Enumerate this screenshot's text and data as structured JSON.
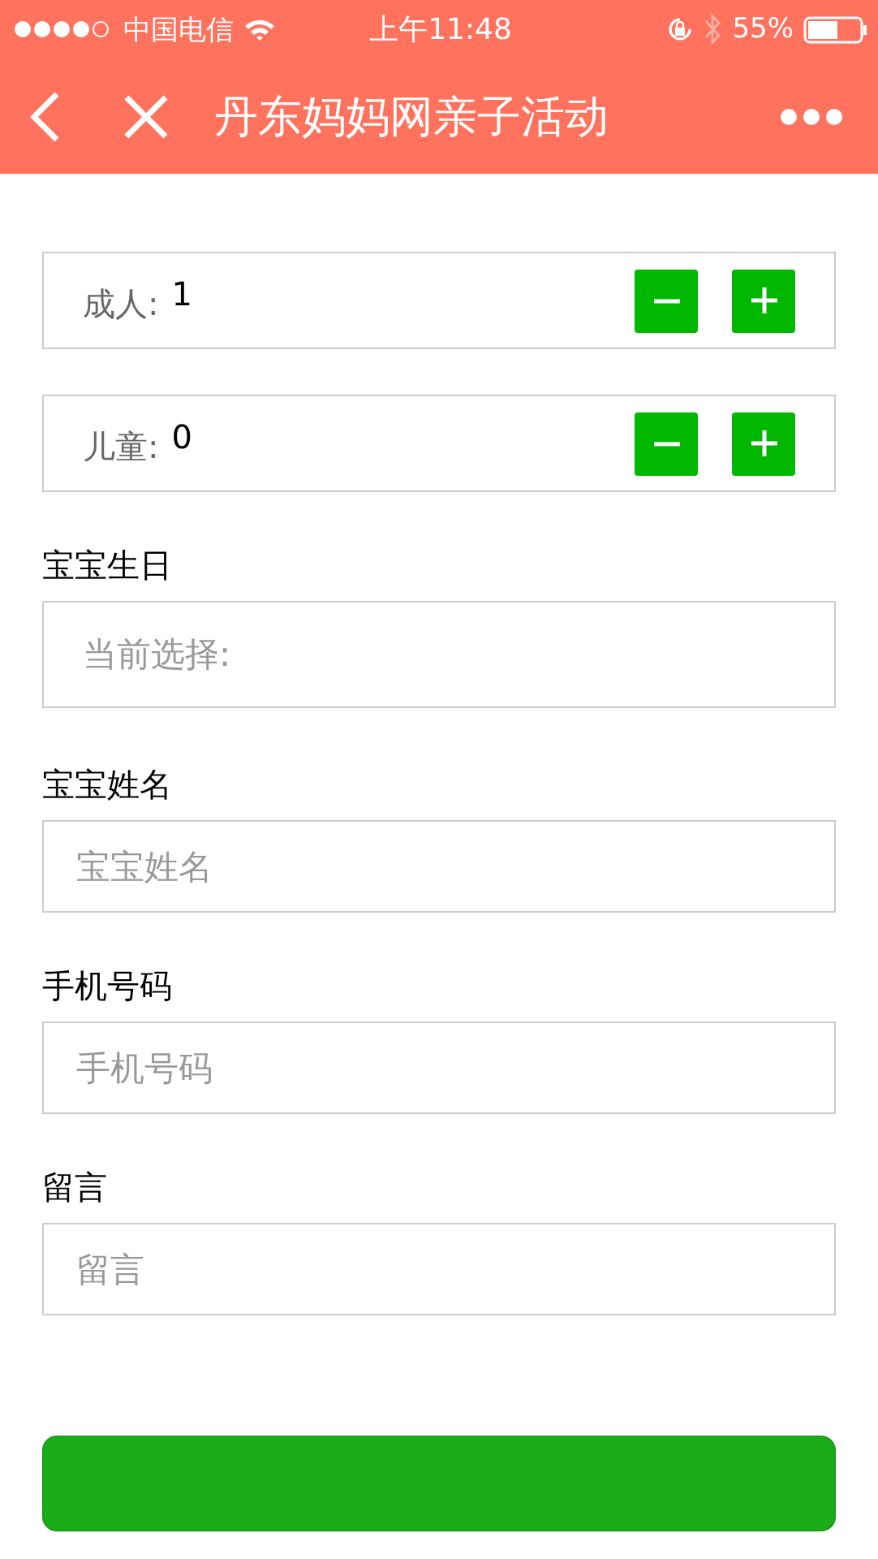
{
  "status_bar": {
    "carrier": "中国电信",
    "time": "上午11:48",
    "battery": "55%"
  },
  "nav": {
    "title": "丹东妈妈网亲子活动"
  },
  "counters": [
    {
      "label": "成人:",
      "value": "1"
    },
    {
      "label": "儿童:",
      "value": "0"
    }
  ],
  "fields": [
    {
      "label": "宝宝生日",
      "placeholder": "当前选择:",
      "kind": "picker"
    },
    {
      "label": "宝宝姓名",
      "placeholder": "宝宝姓名",
      "kind": "input"
    },
    {
      "label": "手机号码",
      "placeholder": "手机号码",
      "kind": "input"
    },
    {
      "label": "留言",
      "placeholder": "留言",
      "kind": "input"
    }
  ]
}
